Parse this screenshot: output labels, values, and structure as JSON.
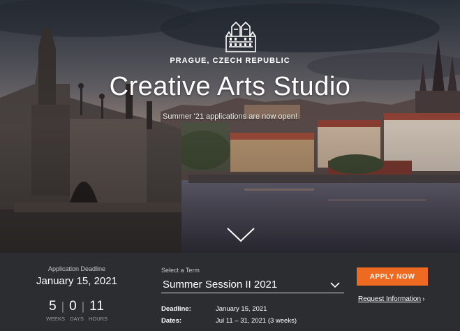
{
  "hero": {
    "location": "PRAGUE, CZECH REPUBLIC",
    "title": "Creative Arts Studio",
    "subtitle": "Summer '21 applications are now open!",
    "logo_icon": "castle-logo-icon",
    "scroll_icon": "chevron-down-icon"
  },
  "deadline": {
    "label": "Application Deadline",
    "date": "January 15, 2021"
  },
  "countdown": {
    "weeks": "5",
    "days": "0",
    "hours": "11",
    "separator": "|",
    "weeks_label": "WEEKS",
    "days_label": "DAYS",
    "hours_label": "HOURS"
  },
  "term": {
    "label": "Select a Term",
    "selected": "Summer Session II 2021",
    "deadline_key": "Deadline:",
    "deadline_value": "January 15, 2021",
    "dates_key": "Dates:",
    "dates_value": "Jul 11 – 31, 2021 (3 weeks)"
  },
  "actions": {
    "apply_label": "APPLY NOW",
    "request_label": "Request Information",
    "request_arrow": "›"
  },
  "colors": {
    "accent": "#ee6a21",
    "bar_background": "#2b2d30"
  }
}
